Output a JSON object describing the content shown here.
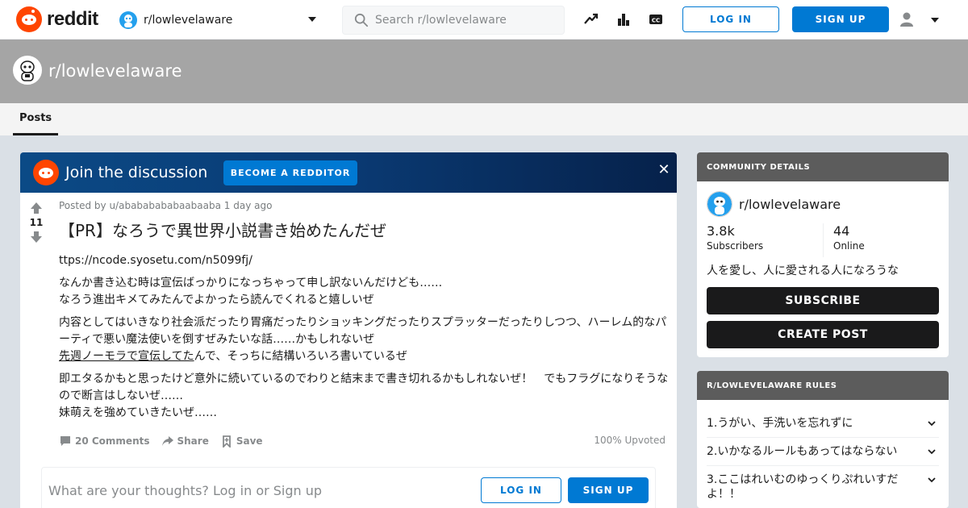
{
  "header": {
    "logo_text": "reddit",
    "community_switch": "r/lowlevelaware",
    "search_placeholder": "Search r/lowlevelaware",
    "login_label": "LOG IN",
    "signup_label": "SIGN UP"
  },
  "banner": {
    "title": "r/lowlevelaware"
  },
  "tabs": [
    {
      "label": "Posts"
    }
  ],
  "join_banner": {
    "title": "Join the discussion",
    "button": "BECOME A REDDITOR",
    "close": "✕"
  },
  "post": {
    "votes": "11",
    "meta": "Posted by u/abababababaabaaba 1 day ago",
    "title": "【PR】なろうで異世界小説書き始めたんだぜ",
    "link": "ttps://ncode.syosetu.com/n5099fj/",
    "p1_line1": "なんか書き込む時は宣伝ばっかりになっちゃって申し訳ないんだけども……",
    "p1_line2": "なろう進出キメてみたんでよかったら読んでくれると嬉しいぜ",
    "p2_line1": "内容としてはいきなり社会派だったり胃痛だったりショッキングだったりスプラッターだったりしつつ、ハーレム的なパーティで悪い魔法使いを倒すぜみたいな話……かもしれないぜ",
    "p2_line2_underlined": "先週ノーモラで宣伝してた",
    "p2_line2_rest": "んで、そっちに結構いろいろ書いているぜ",
    "p3_line1": "即エタるかもと思ったけど意外に続いているのでわりと結末まで書き切れるかもしれないぜ！　でもフラグになりそうなので断言はしないぜ……",
    "p3_line2": "妹萌えを強めていきたいぜ……",
    "comments_label": "20 Comments",
    "share_label": "Share",
    "save_label": "Save",
    "upvoted_label": "100% Upvoted"
  },
  "comment_box": {
    "placeholder": "What are your thoughts? Log in or Sign up",
    "login_label": "LOG IN",
    "signup_label": "SIGN UP"
  },
  "community": {
    "header": "COMMUNITY DETAILS",
    "name": "r/lowlevelaware",
    "subscribers_value": "3.8k",
    "subscribers_label": "Subscribers",
    "online_value": "44",
    "online_label": "Online",
    "description": "人を愛し、人に愛される人になろうな",
    "subscribe_label": "SUBSCRIBE",
    "create_post_label": "CREATE POST"
  },
  "rules": {
    "header": "R/LOWLEVELAWARE RULES",
    "items": [
      {
        "num": "1.",
        "text": "うがい、手洗いを忘れずに"
      },
      {
        "num": "2.",
        "text": "いかなるルールもあってはならない"
      },
      {
        "num": "3.",
        "text": "ここはれいむのゆっくりぷれいすだよ！！"
      }
    ]
  },
  "colors": {
    "accent_blue": "#0079d3",
    "reddit_orange": "#ff4500",
    "banner_gray": "#a5a5a5",
    "dark_button": "#1a1a1b"
  }
}
